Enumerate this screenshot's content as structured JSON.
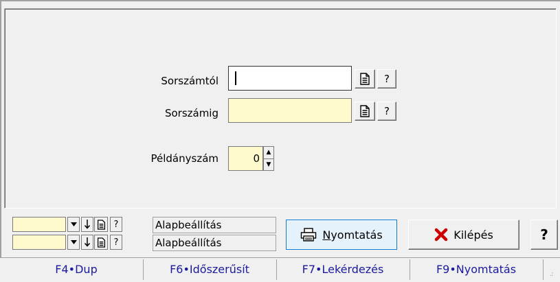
{
  "form": {
    "from_label": "Sorszámtól",
    "from_value": "",
    "to_label": "Sorszámig",
    "to_value": "",
    "copies_label": "Példányszám",
    "copies_value": "0",
    "lookup_help": "?"
  },
  "filters": [
    {
      "value": "",
      "help": "?",
      "preset_label": "Alapbeállítás"
    },
    {
      "value": "",
      "help": "?",
      "preset_label": "Alapbeállítás"
    }
  ],
  "actions": {
    "print_accel": "N",
    "print_rest": "yomtatás",
    "exit_label": "Kilépés",
    "help_label": "?"
  },
  "fkeys": [
    {
      "label": "F4•Dup"
    },
    {
      "label": "F6•Időszerűsít"
    },
    {
      "label": "F7•Lekérdezés"
    },
    {
      "label": "F9•Nyomtatás"
    }
  ],
  "colors": {
    "required_field": "#fffacd",
    "fkey_text": "#1a1a9e",
    "exit_icon": "#cc0000"
  },
  "icons": {
    "lookup": "document-icon",
    "print": "printer-icon",
    "exit": "x-icon"
  }
}
